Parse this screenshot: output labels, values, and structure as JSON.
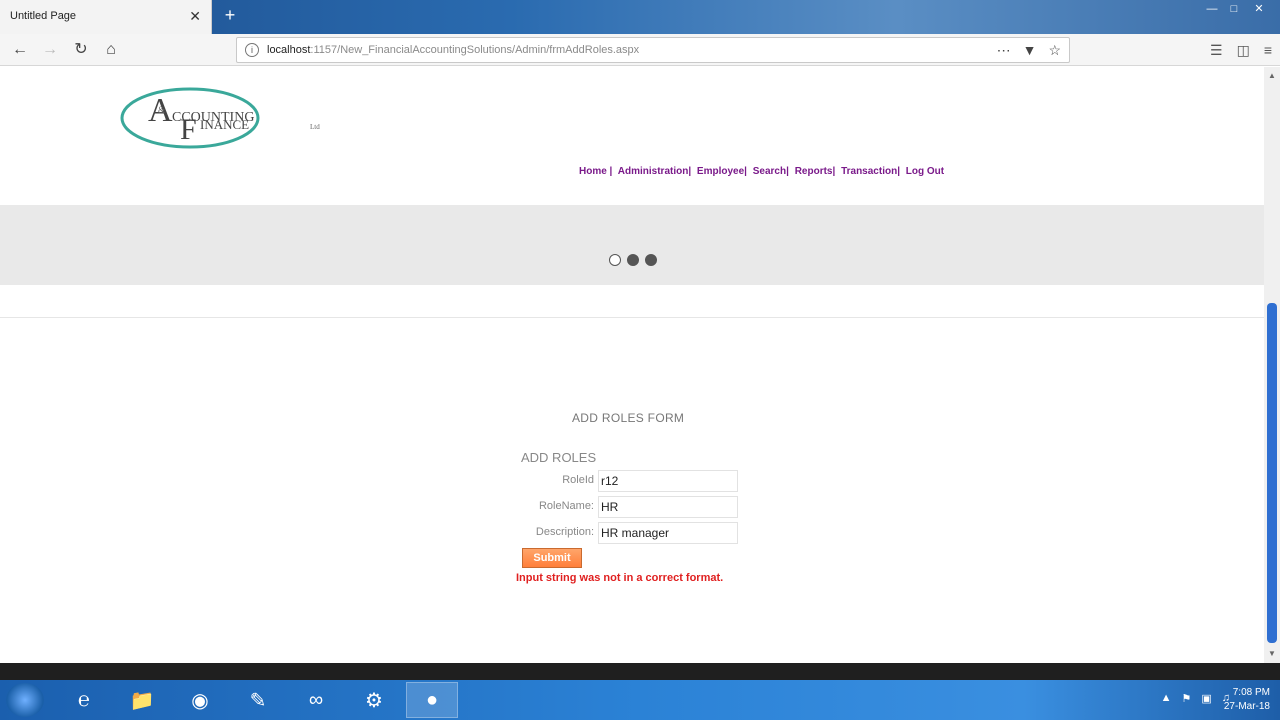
{
  "browser": {
    "tab_title": "Untitled Page",
    "tab_close": "✕",
    "new_tab": "+",
    "url_host": "localhost",
    "url_path": ":1157/New_FinancialAccountingSolutions/Admin/frmAddRoles.aspx"
  },
  "logo": {
    "text_main": "CCOUNTING",
    "text_sub": "INANCE",
    "text_ltd": "Ltd"
  },
  "nav": {
    "items": [
      "Home |",
      "Administration|",
      "Employee|",
      "Search|",
      "Reports|",
      "Transaction|",
      "Log Out"
    ]
  },
  "form": {
    "title": "ADD ROLES FORM",
    "section": "ADD ROLES",
    "roleid_label": "RoleId",
    "roleid_value": "r12",
    "rolename_label": "RoleName:",
    "rolename_value": "HR",
    "description_label": "Description:",
    "description_value": "HR manager",
    "submit_label": "Submit",
    "error": "Input string was not in a correct format."
  },
  "taskbar": {
    "time": "7:08 PM",
    "date": "27-Mar-18"
  },
  "colors": {
    "nav_link": "#7a1a8a",
    "error": "#e02020",
    "submit": "#ff8c4a",
    "scroll_thumb": "#2f6fd1"
  }
}
